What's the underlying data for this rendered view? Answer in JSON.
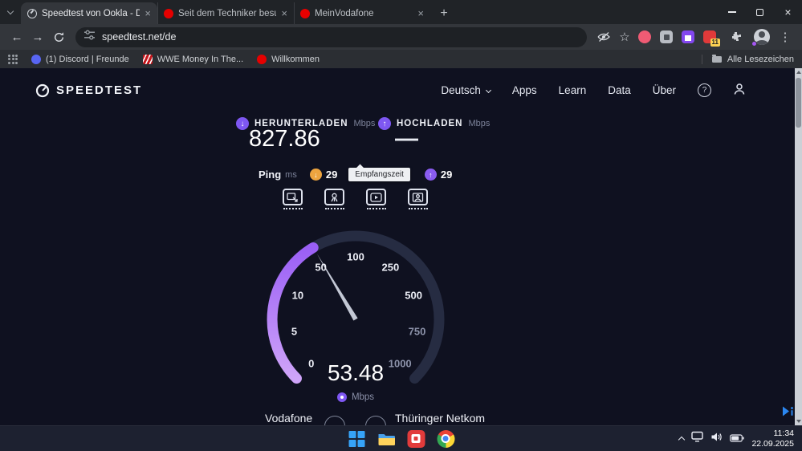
{
  "browser": {
    "tabs": [
      {
        "title": "Speedtest von Ookla - Der umf...",
        "active": true
      },
      {
        "title": "Seit dem Techniker besuch seh...",
        "active": false
      },
      {
        "title": "MeinVodafone",
        "active": false
      }
    ],
    "address": "speedtest.net/de",
    "extension_badge": "11",
    "bookmarks_bar": {
      "items": [
        {
          "label": "(1) Discord | Freunde"
        },
        {
          "label": "WWE Money In The..."
        },
        {
          "label": "Willkommen"
        }
      ],
      "all_bookmarks": "Alle Lesezeichen"
    }
  },
  "page": {
    "brand": "SPEEDTEST",
    "nav": {
      "language": "Deutsch",
      "items": [
        "Apps",
        "Learn",
        "Data",
        "Über"
      ]
    },
    "results": {
      "download": {
        "label": "HERUNTERLADEN",
        "unit": "Mbps",
        "value": "827.86"
      },
      "upload": {
        "label": "HOCHLADEN",
        "unit": "Mbps",
        "value": "—"
      },
      "ping": {
        "label": "Ping",
        "unit": "ms",
        "receive": "29",
        "send": "29"
      },
      "tooltip": "Empfangszeit"
    },
    "gauge": {
      "ticks": [
        "0",
        "5",
        "10",
        "50",
        "100",
        "250",
        "500",
        "750",
        "1000"
      ],
      "value": "53.48",
      "unit": "Mbps"
    },
    "connection": {
      "isp": "Vodafone",
      "server": "Thüringer Netkom"
    }
  },
  "taskbar": {
    "time": "11:34",
    "date": "22.09.2025"
  },
  "icons": {
    "close": "×",
    "new_tab": "+",
    "back": "←",
    "forward": "→",
    "star": "☆",
    "menu": "⋮",
    "question": "?",
    "down_arrow": "↓",
    "up_arrow": "↑"
  },
  "colors": {
    "accent_purple": "#8a5cf0",
    "ping_orange": "#eda43f",
    "vodafone_red": "#e60000",
    "page_background": "#0f1120"
  }
}
